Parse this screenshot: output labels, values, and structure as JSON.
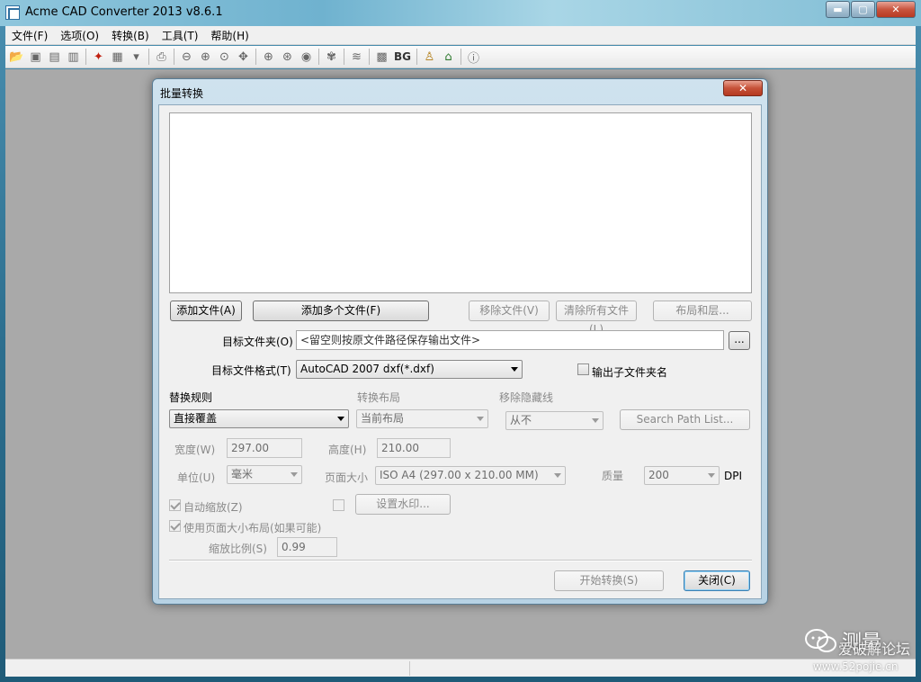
{
  "app": {
    "title": "Acme CAD Converter 2013 v8.6.1",
    "window_buttons": {
      "minimize": "▬",
      "maximize": "▢",
      "close": "✕"
    }
  },
  "menu": [
    "文件(F)",
    "选项(O)",
    "转换(B)",
    "工具(T)",
    "帮助(H)"
  ],
  "toolbar": {
    "bg_label": "BG",
    "icons": [
      "open-folder-icon",
      "save-icon",
      "save-all-icon",
      "export-icon",
      "pdf-icon",
      "batch-icon",
      "print-icon",
      "zoom-out-icon",
      "zoom-in-icon",
      "zoom-window-icon",
      "zoom-pan-icon",
      "zoom-all-icon",
      "zoom-extent-icon",
      "view-icon",
      "layers-icon",
      "lines-icon",
      "grid-icon",
      "bg-text",
      "info-person-icon",
      "home-icon",
      "info-icon"
    ]
  },
  "dialog": {
    "title": "批量转换",
    "close_glyph": "✕",
    "buttons": {
      "add_file": "添加文件(A)",
      "add_multiple": "添加多个文件(F)",
      "remove_file": "移除文件(V)",
      "clear_all": "清除所有文件(L)",
      "layout_layers": "布局和层...",
      "browse": "...",
      "search_path": "Search Path List...",
      "watermark": "设置水印...",
      "start": "开始转换(S)",
      "close": "关闭(C)"
    },
    "target_folder": {
      "label": "目标文件夹(O)",
      "value": "<留空则按原文件路径保存输出文件>"
    },
    "target_format": {
      "label": "目标文件格式(T)",
      "value": "AutoCAD 2007 dxf(*.dxf)"
    },
    "output_subfolder": {
      "label": "输出子文件夹名",
      "checked": false
    },
    "replace_rule": {
      "label": "替换规则",
      "value": "直接覆盖"
    },
    "convert_layout": {
      "label": "转换布局",
      "value": "当前布局"
    },
    "remove_hidden": {
      "label": "移除隐藏线",
      "value": "从不"
    },
    "width": {
      "label": "宽度(W)",
      "value": "297.00"
    },
    "height": {
      "label": "高度(H)",
      "value": "210.00"
    },
    "unit": {
      "label": "单位(U)",
      "value": "毫米"
    },
    "page_size": {
      "label": "页面大小",
      "value": "ISO A4 (297.00 x 210.00 MM)"
    },
    "quality": {
      "label": "质量",
      "value": "200",
      "unit": "DPI"
    },
    "auto_zoom": {
      "label": "自动缩放(Z)",
      "checked": true
    },
    "watermark_checkbox": {
      "checked": false
    },
    "use_page_layout": {
      "label": "使用页面大小布局(如果可能)",
      "checked": true
    },
    "zoom_ratio": {
      "label": "缩放比例(S)",
      "value": "0.99"
    }
  },
  "watermark": {
    "text1": "测量",
    "text2": "爱破解论坛",
    "url": "www.52pojie.cn"
  },
  "colors": {
    "workspace": "#a9a9a9",
    "dialog_frame": "#b7d2e4",
    "close_red": "#c65138"
  }
}
